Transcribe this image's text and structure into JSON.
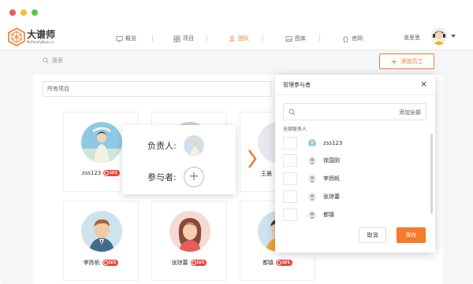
{
  "colors": {
    "accent": "#f07a2a",
    "badge": "#e9483c",
    "close": "#f05a4f",
    "minimize": "#f6be3b",
    "zoom": "#5ac63e"
  },
  "brand": {
    "name": "大谱师",
    "sub": "MyFamilyBook.cn"
  },
  "nav": [
    {
      "label": "概览",
      "icon": "monitor-icon",
      "active": false
    },
    {
      "label": "项目",
      "icon": "grid-icon",
      "active": false
    },
    {
      "label": "团队",
      "icon": "team-icon",
      "active": true
    },
    {
      "label": "图库",
      "icon": "image-icon",
      "active": false
    },
    {
      "label": "官网",
      "icon": "home-icon",
      "active": false
    }
  ],
  "user": {
    "name": "張思思"
  },
  "toolbar": {
    "search_label": "搜索",
    "add_label": "添加员工"
  },
  "filter": {
    "value": "所有项目"
  },
  "cards": [
    {
      "name": "zss123",
      "level": "LV1"
    },
    {
      "name": "",
      "level": ""
    },
    {
      "name": "王晨",
      "level": ""
    },
    {
      "name": "李扬帆",
      "level": "LV1"
    },
    {
      "name": "张琼蕾",
      "level": "LV1"
    },
    {
      "name": "都镇",
      "level": "LV1"
    }
  ],
  "popup": {
    "owner_label": "负责人:",
    "participant_label": "参与者:",
    "add_symbol": "+"
  },
  "panel": {
    "title": "管理参与者",
    "close": "×",
    "add_all": "添加全部",
    "all_contacts": "全部联系人",
    "contacts": [
      "zss123",
      "徐国刚",
      "李扬帆",
      "张琼蕾",
      "都镇"
    ],
    "cancel": "取消",
    "save": "保存"
  }
}
